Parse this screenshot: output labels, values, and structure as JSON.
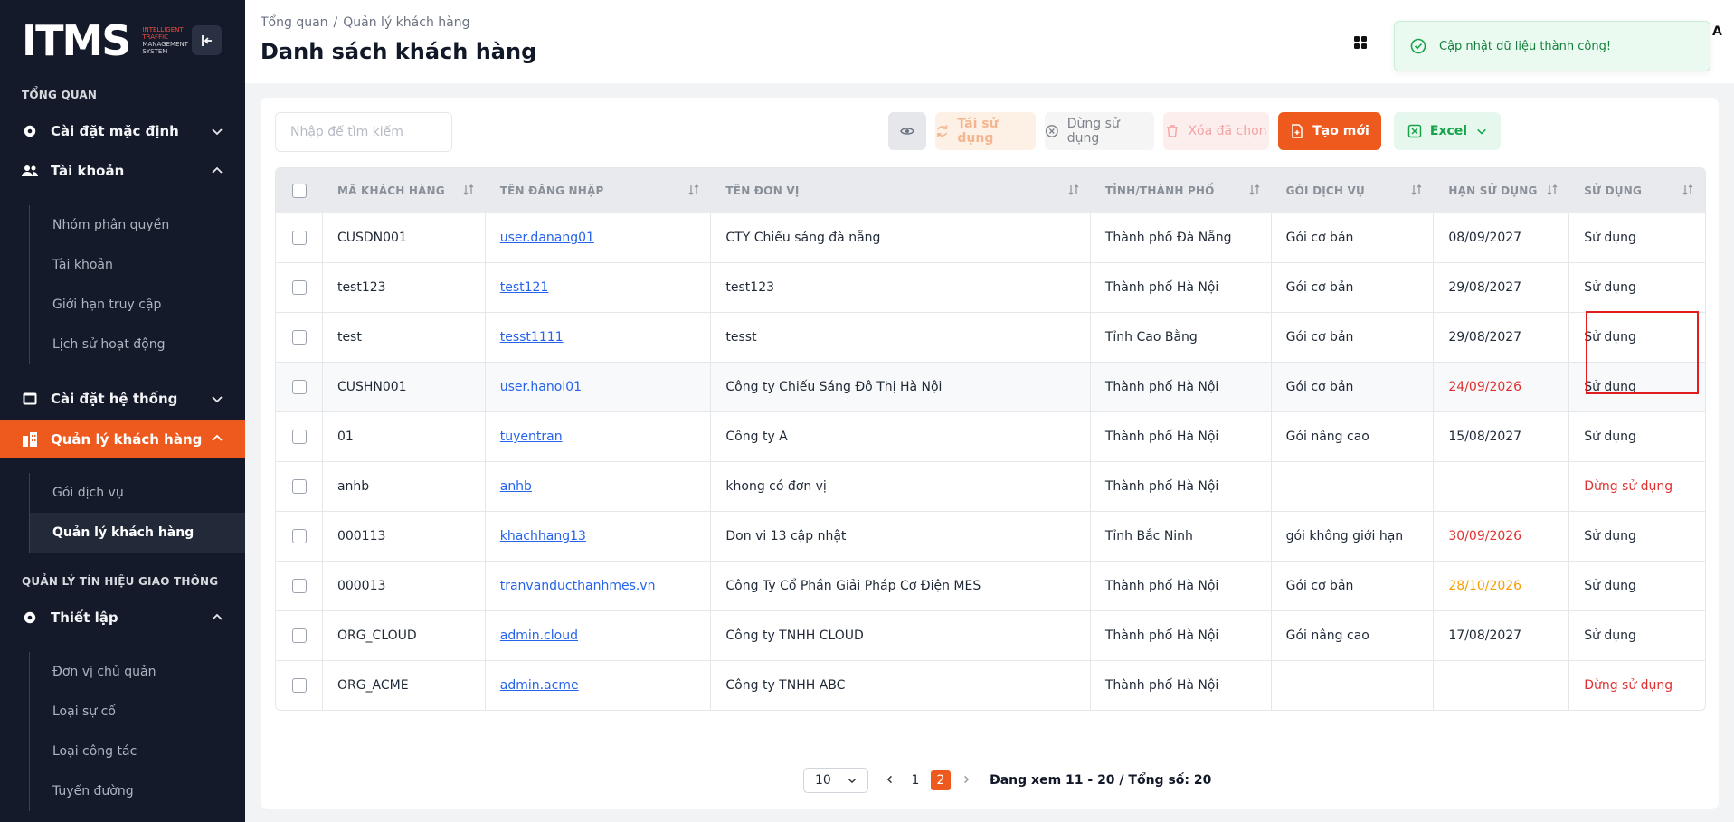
{
  "brand": {
    "logo": "ITMS",
    "tagline": [
      "INTELLIGENT",
      "TRAFFIC",
      "MANAGEMENT",
      "SYSTEM"
    ]
  },
  "sidebar": {
    "section_overview": "TỔNG QUAN",
    "default_settings": "Cài đặt mặc định",
    "account": "Tài khoản",
    "account_items": [
      "Nhóm phân quyền",
      "Tài khoản",
      "Giới hạn truy cập",
      "Lịch sử hoạt động"
    ],
    "system_settings": "Cài đặt hệ thống",
    "customer_mgmt": "Quản lý khách hàng",
    "customer_items": [
      "Gói dịch vụ",
      "Quản lý khách hàng"
    ],
    "section_traffic": "QUẢN LÝ TÍN HIỆU GIAO THÔNG",
    "setup": "Thiết lập",
    "setup_items": [
      "Đơn vị chủ quản",
      "Loại sự cố",
      "Loại công tác",
      "Tuyến đường"
    ]
  },
  "header": {
    "breadcrumb_home": "Tổng quan",
    "breadcrumb_sep": "/",
    "breadcrumb_current": "Quản lý khách hàng",
    "title": "Danh sách khách hàng",
    "user_letter": "A"
  },
  "toast": {
    "message": "Cập nhật dữ liệu thành công!"
  },
  "toolbar": {
    "search_placeholder": "Nhập để tìm kiếm",
    "reuse": "Tái sử dụng",
    "stop": "Dừng sử dụng",
    "delete_selected": "Xóa đã chọn",
    "create": "Tạo mới",
    "excel": "Excel"
  },
  "table": {
    "columns": [
      "MÃ KHÁCH HÀNG",
      "TÊN ĐĂNG NHẬP",
      "TÊN ĐƠN VỊ",
      "TỈNH/THÀNH PHỐ",
      "GÓI DỊCH VỤ",
      "HẠN SỬ DỤNG",
      "SỬ DỤNG"
    ],
    "rows": [
      {
        "code": "CUSDN001",
        "username": "user.danang01",
        "unit": "CTY Chiếu sáng đà nẵng",
        "province": "Thành phố Đà Nẵng",
        "package": "Gói cơ bản",
        "expiry": "08/09/2027",
        "expiry_color": "normal",
        "status": "Sử dụng",
        "status_color": "normal"
      },
      {
        "code": "test123",
        "username": "test121",
        "unit": "test123",
        "province": "Thành phố Hà Nội",
        "package": "Gói cơ bản",
        "expiry": "29/08/2027",
        "expiry_color": "normal",
        "status": "Sử dụng",
        "status_color": "normal"
      },
      {
        "code": "test",
        "username": "tesst1111",
        "unit": "tesst",
        "province": "Tỉnh Cao Bằng",
        "package": "Gói cơ bản",
        "expiry": "29/08/2027",
        "expiry_color": "normal",
        "status": "Sử dụng",
        "status_color": "normal"
      },
      {
        "code": "CUSHN001",
        "username": "user.hanoi01",
        "unit": "Công ty Chiếu Sáng Đô Thị Hà Nội",
        "province": "Thành phố Hà Nội",
        "package": "Gói cơ bản",
        "expiry": "24/09/2026",
        "expiry_color": "red",
        "status": "Sử dụng",
        "status_color": "normal"
      },
      {
        "code": "01",
        "username": "tuyentran",
        "unit": "Công ty A",
        "province": "Thành phố Hà Nội",
        "package": "Gói nâng cao",
        "expiry": "15/08/2027",
        "expiry_color": "normal",
        "status": "Sử dụng",
        "status_color": "normal"
      },
      {
        "code": "anhb",
        "username": "anhb",
        "unit": "khong có đơn vị",
        "province": "Thành phố Hà Nội",
        "package": "",
        "expiry": "",
        "expiry_color": "normal",
        "status": "Dừng sử dụng",
        "status_color": "red"
      },
      {
        "code": "000113",
        "username": "khachhang13",
        "unit": "Don vi 13 cập nhật",
        "province": "Tỉnh Bắc Ninh",
        "package": "gói không giới hạn",
        "expiry": "30/09/2026",
        "expiry_color": "red",
        "status": "Sử dụng",
        "status_color": "normal"
      },
      {
        "code": "000013",
        "username": "tranvanducthanhmes.vn",
        "unit": "Công Ty Cổ Phần Giải Pháp Cơ Điện MES",
        "province": "Thành phố Hà Nội",
        "package": "Gói cơ bản",
        "expiry": "28/10/2026",
        "expiry_color": "orange",
        "status": "Sử dụng",
        "status_color": "normal"
      },
      {
        "code": "ORG_CLOUD",
        "username": "admin.cloud",
        "unit": "Công ty TNHH CLOUD",
        "province": "Thành phố Hà Nội",
        "package": "Gói nâng cao",
        "expiry": "17/08/2027",
        "expiry_color": "normal",
        "status": "Sử dụng",
        "status_color": "normal"
      },
      {
        "code": "ORG_ACME",
        "username": "admin.acme",
        "unit": "Công ty TNHH ABC",
        "province": "Thành phố Hà Nội",
        "package": "",
        "expiry": "",
        "expiry_color": "normal",
        "status": "Dừng sử dụng",
        "status_color": "red"
      }
    ]
  },
  "pagination": {
    "page_size": "10",
    "pages": [
      "1",
      "2"
    ],
    "current": "2",
    "info": "Đang xem 11 - 20 / Tổng số: 20"
  },
  "colors": {
    "accent": "#ee5a1d",
    "sidebar_bg": "#141a29",
    "link": "#2563eb",
    "danger": "#e03131",
    "warning": "#f59f00",
    "success": "#16a34a"
  }
}
